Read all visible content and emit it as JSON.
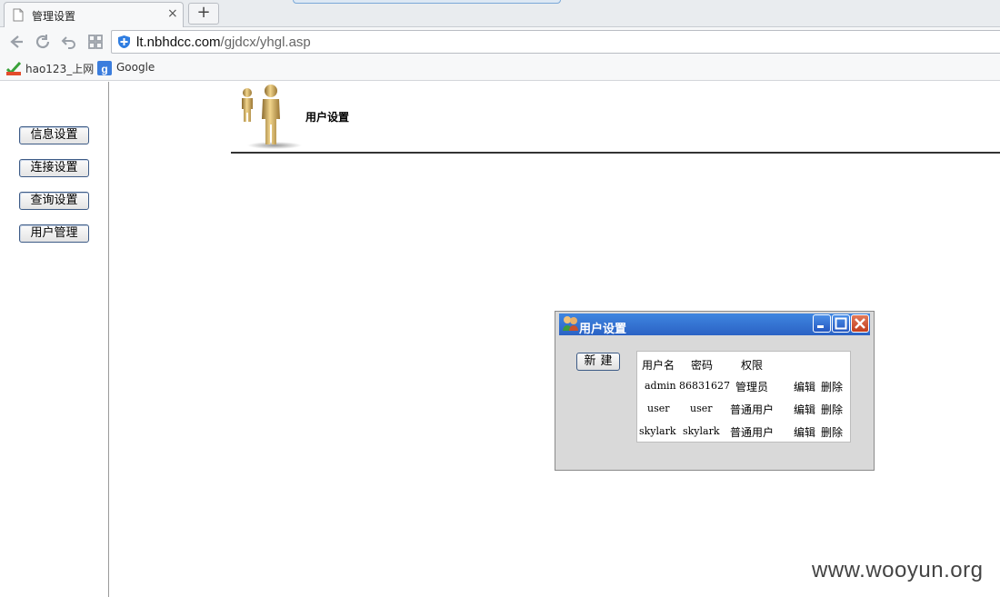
{
  "browser": {
    "tab_title": "管理设置",
    "tab_close": "×",
    "new_tab": "+",
    "address_host": "lt.nbhdcc.com",
    "address_path": "/gjdcx/yhgl.asp",
    "bookmarks": [
      {
        "label": "hao123_上网",
        "icon": "hao123-icon"
      },
      {
        "label": "Google",
        "icon": "google-icon"
      }
    ]
  },
  "sidebar": {
    "items": [
      {
        "label": "信息设置"
      },
      {
        "label": "连接设置"
      },
      {
        "label": "查询设置"
      },
      {
        "label": "用户管理"
      }
    ]
  },
  "header": {
    "title": "用户设置"
  },
  "dialog": {
    "title": "用户设置",
    "new_button": "新建",
    "columns": [
      "用户名",
      "密码",
      "权限"
    ],
    "rows": [
      {
        "username": "admin",
        "password": "86831627",
        "role": "管理员",
        "edit": "编辑",
        "delete": "删除"
      },
      {
        "username": "user",
        "password": "user",
        "role": "普通用户",
        "edit": "编辑",
        "delete": "删除"
      },
      {
        "username": "skylark",
        "password": "skylark",
        "role": "普通用户",
        "edit": "编辑",
        "delete": "删除"
      }
    ]
  },
  "watermark": "www.wooyun.org",
  "colors": {
    "title_bar": "#2b62c4",
    "close_button": "#c23d1d",
    "dialog_bg": "#d9d9d9"
  }
}
